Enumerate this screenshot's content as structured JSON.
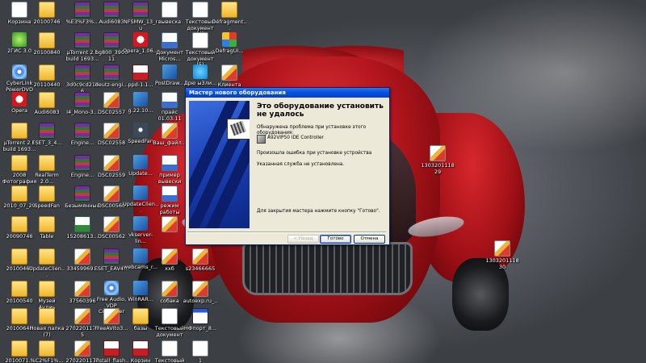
{
  "desktop": {
    "icons": [
      {
        "label": "Корзина",
        "type": "g-doc"
      },
      {
        "label": "20100746",
        "type": "g-folder"
      },
      {
        "label": "%E3%F3%...",
        "type": "g-rar"
      },
      {
        "label": "Audi6083",
        "type": "g-rar"
      },
      {
        "label": "NFSMW_13_ru",
        "type": "g-rar"
      },
      {
        "label": "вывеска",
        "type": "g-doc"
      },
      {
        "label": "Текстовый документ (4)",
        "type": "g-doc"
      },
      {
        "label": "Défragment...",
        "type": "g-folder"
      },
      {
        "label": "2ГИС 3.0",
        "type": "g-green"
      },
      {
        "label": "20100840",
        "type": "g-folder"
      },
      {
        "label": "µTorrent 2.1 build 1693...",
        "type": "g-rar"
      },
      {
        "label": "bg800_390911",
        "type": "g-rar"
      },
      {
        "label": "Opera_1.06...",
        "type": "g-opera"
      },
      {
        "label": "Документ Micros...",
        "type": "g-word"
      },
      {
        "label": "Текстовый документ (5)",
        "type": "g-doc"
      },
      {
        "label": "DefragUI...",
        "type": "g-multi"
      },
      {
        "label": "CyberLink PowerDVD 10",
        "type": "g-cd"
      },
      {
        "label": "20110440",
        "type": "g-folder"
      },
      {
        "label": "3d0c9cd21b6",
        "type": "g-rar"
      },
      {
        "label": "deutz-engi...",
        "type": "g-rar"
      },
      {
        "label": "ppd-1.1...",
        "type": "g-pdf"
      },
      {
        "label": "PostDraw...",
        "type": "g-app"
      },
      {
        "label": "Дрю ыЗли...",
        "type": "g-skype"
      },
      {
        "label": "Клиента вывеска",
        "type": "g-jpg"
      },
      {
        "label": "Opera",
        "type": "g-opera"
      },
      {
        "label": "Audi6083",
        "type": "g-folder"
      },
      {
        "label": "I4_Mono-3...",
        "type": "g-rar"
      },
      {
        "label": "DSC02557",
        "type": "g-jpg"
      },
      {
        "label": "g.22.10...",
        "type": "g-app"
      },
      {
        "label": "прайс 01.03.11",
        "type": "g-word"
      },
      {
        "label": "µTorrent 2.1 build 1693...",
        "type": "g-folder"
      },
      {
        "label": "ESET_3_4...",
        "type": "g-rar"
      },
      {
        "label": "Engine...",
        "type": "g-rar"
      },
      {
        "label": "DSC02558",
        "type": "g-jpg"
      },
      {
        "label": "SpeedFan",
        "type": "g-fan"
      },
      {
        "label": "Ваш_файл...",
        "type": "g-jpg"
      },
      {
        "label": "2008 Фотография...",
        "type": "g-folder"
      },
      {
        "label": "RealTerm 2.0...",
        "type": "g-folder"
      },
      {
        "label": "Engine...",
        "type": "g-rar"
      },
      {
        "label": "DSC02559",
        "type": "g-jpg"
      },
      {
        "label": "Update...",
        "type": "g-app"
      },
      {
        "label": "пример вывески",
        "type": "g-word"
      },
      {
        "label": "2010_07_29",
        "type": "g-folder"
      },
      {
        "label": "SpeedFan",
        "type": "g-folder"
      },
      {
        "label": "Безымянный",
        "type": "g-rar"
      },
      {
        "label": "DSC00560",
        "type": "g-jpg"
      },
      {
        "label": "UpdateClien...",
        "type": "g-app"
      },
      {
        "label": "режим работы",
        "type": "g-word"
      },
      {
        "label": "20090746",
        "type": "g-folder"
      },
      {
        "label": "Table",
        "type": "g-folder"
      },
      {
        "label": "15208613...",
        "type": "g-excel"
      },
      {
        "label": "DSC00562",
        "type": "g-jpg"
      },
      {
        "label": "vkserver-lin...",
        "type": "g-app"
      },
      {
        "label": "",
        "type": "g-jpg"
      },
      {
        "label": "20100460",
        "type": "g-folder"
      },
      {
        "label": "UpdateClien...",
        "type": "g-folder"
      },
      {
        "label": "33459969...",
        "type": "g-jpg"
      },
      {
        "label": "ESET_EAV4...",
        "type": "g-rar"
      },
      {
        "label": "webcams_r...",
        "type": "g-app"
      },
      {
        "label": "ххб",
        "type": "g-jpg"
      },
      {
        "label": "s23466665",
        "type": "g-jpg"
      },
      {
        "label": "20100540",
        "type": "g-folder"
      },
      {
        "label": "Музей Аудиь",
        "type": "g-folder"
      },
      {
        "label": "37560396",
        "type": "g-jpg"
      },
      {
        "label": "Free Audio, VDP Converter",
        "type": "g-cd"
      },
      {
        "label": "WinRAR...",
        "type": "g-app"
      },
      {
        "label": "собака",
        "type": "g-jpg"
      },
      {
        "label": "autoexp.ru_...",
        "type": "g-jpg"
      },
      {
        "label": "20100640",
        "type": "g-folder"
      },
      {
        "label": "Новая папка (7)",
        "type": "g-folder"
      },
      {
        "label": "27022011775",
        "type": "g-jpg"
      },
      {
        "label": "FreeAVIto3...",
        "type": "g-jpg"
      },
      {
        "label": "базы",
        "type": "g-folder"
      },
      {
        "label": "Текстовый документ",
        "type": "g-doc"
      },
      {
        "label": "НФпорт_8...",
        "type": "g-win"
      },
      {
        "label": "2010071...",
        "type": "g-folder"
      },
      {
        "label": "%C2%F1%...",
        "type": "g-folder"
      },
      {
        "label": "27022011776",
        "type": "g-jpg"
      },
      {
        "label": "install_flash...",
        "type": "g-pdf"
      },
      {
        "label": "Корзин И4_Моно-3...",
        "type": "g-pdf"
      },
      {
        "label": "Текстовый документ (3)",
        "type": "g-doc"
      },
      {
        "label": "1",
        "type": "g-doc"
      },
      {
        "label": "130320111829",
        "type": "g-jpg"
      },
      {
        "label": "130320111830",
        "type": "g-jpg"
      }
    ]
  },
  "wizard": {
    "title": "Мастер нового оборудования",
    "heading": "Это оборудование установить не удалось",
    "problem_text": "Обнаружена проблема при установке этого оборудования:",
    "device_name": "A92VIP50 IDE Controller",
    "error_text": "Произошла ошибка при установке устройства",
    "service_text": "Указанная служба не установлена.",
    "close_hint": "Для закрытия мастера нажмите кнопку \"Готово\".",
    "buttons": {
      "back": "< Назад",
      "finish": "Готово",
      "cancel": "Отмена"
    }
  }
}
